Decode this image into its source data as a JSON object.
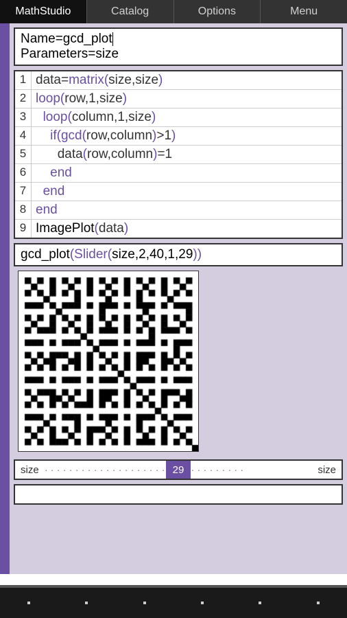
{
  "topbar": {
    "items": [
      "MathStudio",
      "Catalog",
      "Options",
      "Menu"
    ],
    "active": 0
  },
  "header": {
    "line1_key": "Name",
    "line1_val": "gcd_plot",
    "line2_key": "Parameters",
    "line2_val": "size"
  },
  "code": [
    {
      "n": "1",
      "tokens": [
        {
          "t": "data",
          "c": "arg"
        },
        {
          "t": "=",
          "c": "arg"
        },
        {
          "t": "matrix",
          "c": "kw"
        },
        {
          "t": "(",
          "c": "paren"
        },
        {
          "t": "size,size",
          "c": "arg"
        },
        {
          "t": ")",
          "c": "paren"
        }
      ],
      "indent": 0
    },
    {
      "n": "2",
      "tokens": [
        {
          "t": "loop",
          "c": "kw"
        },
        {
          "t": "(",
          "c": "paren"
        },
        {
          "t": "row,1,size",
          "c": "arg"
        },
        {
          "t": ")",
          "c": "paren"
        }
      ],
      "indent": 0
    },
    {
      "n": "3",
      "tokens": [
        {
          "t": "loop",
          "c": "kw"
        },
        {
          "t": "(",
          "c": "paren"
        },
        {
          "t": "column,1,size",
          "c": "arg"
        },
        {
          "t": ")",
          "c": "paren"
        }
      ],
      "indent": 1
    },
    {
      "n": "4",
      "tokens": [
        {
          "t": "if",
          "c": "kw"
        },
        {
          "t": "(",
          "c": "paren"
        },
        {
          "t": "gcd",
          "c": "kw"
        },
        {
          "t": "(",
          "c": "paren"
        },
        {
          "t": "row,column",
          "c": "arg"
        },
        {
          "t": ")",
          "c": "paren"
        },
        {
          "t": ">1",
          "c": "arg"
        },
        {
          "t": ")",
          "c": "paren"
        }
      ],
      "indent": 2
    },
    {
      "n": "5",
      "tokens": [
        {
          "t": "data",
          "c": "arg"
        },
        {
          "t": "(",
          "c": "paren"
        },
        {
          "t": "row,column",
          "c": "arg"
        },
        {
          "t": ")",
          "c": "paren"
        },
        {
          "t": "=1",
          "c": "arg"
        }
      ],
      "indent": 3
    },
    {
      "n": "6",
      "tokens": [
        {
          "t": "end",
          "c": "kw"
        }
      ],
      "indent": 2
    },
    {
      "n": "7",
      "tokens": [
        {
          "t": "end",
          "c": "kw"
        }
      ],
      "indent": 1
    },
    {
      "n": "8",
      "tokens": [
        {
          "t": "end",
          "c": "kw"
        }
      ],
      "indent": 0
    },
    {
      "n": "9",
      "tokens": [
        {
          "t": "ImagePlot",
          "c": "fn"
        },
        {
          "t": "(",
          "c": "paren"
        },
        {
          "t": "data",
          "c": "arg"
        },
        {
          "t": ")",
          "c": "paren"
        }
      ],
      "indent": 0
    }
  ],
  "call": {
    "fn": "gcd_plot",
    "inner": "Slider",
    "args": "size,2,40,1,29"
  },
  "slider": {
    "label_left": "size",
    "value": "29",
    "label_right": "size",
    "min": 2,
    "max": 40,
    "step": 1,
    "current": 29
  },
  "chart_data": {
    "type": "heatmap",
    "title": "ImagePlot(data)",
    "description": "29×29 binary matrix; cell(r,c)=1 if gcd(r,c)>1 else 0; 1=black, 0=white",
    "size": 29,
    "rule": "gcd(row,col)>1",
    "colors": {
      "0": "#ffffff",
      "1": "#000000"
    }
  }
}
